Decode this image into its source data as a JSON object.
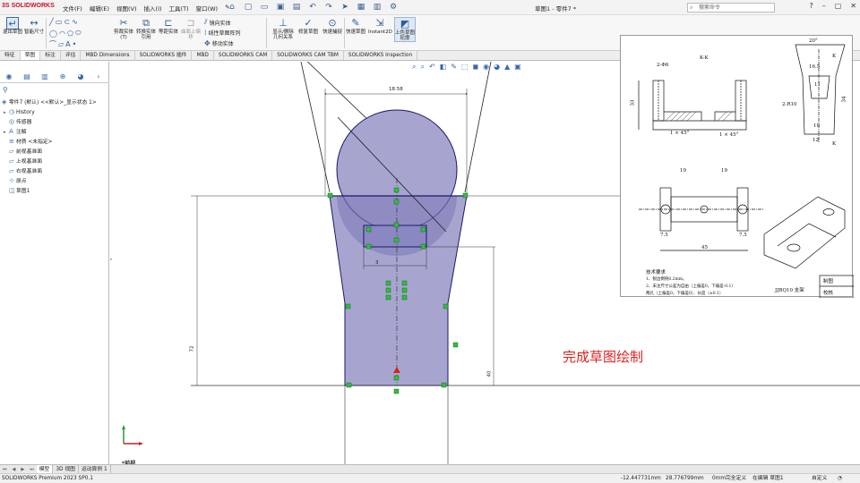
{
  "app": {
    "logo_text": "SOLIDWORKS",
    "logo_mark": "3S",
    "document_title": "草图1 - 零件7 *"
  },
  "menu": {
    "items": [
      "文件(F)",
      "编辑(E)",
      "视图(V)",
      "插入(I)",
      "工具(T)",
      "窗口(W)"
    ]
  },
  "search": {
    "placeholder": "搜索命令"
  },
  "ribbon": {
    "buttons": [
      {
        "label": "退出草图",
        "icon": "exit-sketch-icon"
      },
      {
        "label": "智能尺寸",
        "icon": "smart-dimension-icon"
      },
      {
        "label": "剪裁实体(T)",
        "icon": "trim-icon"
      },
      {
        "label": "转换实体引用",
        "icon": "convert-entities-icon"
      },
      {
        "label": "等距实体",
        "icon": "offset-entities-icon"
      },
      {
        "label": "曲面上偏移",
        "icon": "offset-surface-icon"
      },
      {
        "label": "显示/删除几何关系",
        "icon": "relations-icon"
      },
      {
        "label": "修复草图",
        "icon": "repair-sketch-icon"
      },
      {
        "label": "快速捕捉",
        "icon": "quick-snap-icon"
      },
      {
        "label": "快速草图",
        "icon": "rapid-sketch-icon"
      },
      {
        "label": "Instant2D",
        "icon": "instant2d-icon"
      },
      {
        "label": "上色草图轮廓",
        "icon": "shaded-sketch-icon"
      }
    ],
    "small_items": [
      "镜向实体",
      "线性草图阵列",
      "移动实体"
    ]
  },
  "command_tabs": [
    "特征",
    "草图",
    "标注",
    "评估",
    "MBD Dimensions",
    "SOLIDWORKS 插件",
    "MBD",
    "SOLIDWORKS CAM",
    "SOLIDWORKS CAM TBM",
    "SOLIDWORKS Inspection"
  ],
  "active_command_tab": "草图",
  "tree": {
    "root": "零件7 (默认) <<默认>_显示状态 1>",
    "items": [
      {
        "label": "History",
        "icon": "history-icon",
        "expandable": true
      },
      {
        "label": "传感器",
        "icon": "sensor-icon",
        "expandable": false
      },
      {
        "label": "注解",
        "icon": "annotation-icon",
        "expandable": true
      },
      {
        "label": "材质 <未指定>",
        "icon": "material-icon",
        "expandable": false
      },
      {
        "label": "前视基准面",
        "icon": "plane-icon",
        "expandable": false
      },
      {
        "label": "上视基准面",
        "icon": "plane-icon",
        "expandable": false
      },
      {
        "label": "右视基准面",
        "icon": "plane-icon",
        "expandable": false
      },
      {
        "label": "原点",
        "icon": "origin-icon",
        "expandable": false
      },
      {
        "label": "草图1",
        "icon": "sketch-icon",
        "expandable": false
      }
    ]
  },
  "sketch": {
    "dim_top": "18.58",
    "dim_left": "72",
    "dim_right": "40",
    "dim_inner": "3",
    "view_name": "*前视"
  },
  "overlay_caption": "完成草图绘制",
  "reference": {
    "section_label": "K-K",
    "k_marks": [
      "K",
      "K"
    ],
    "dims": [
      "2-Φ6",
      "33",
      "1 × 45°",
      "1 × 45°",
      "20°",
      "16.5",
      "11",
      "2-R10",
      "10",
      "12",
      "19",
      "19",
      "45",
      "7.5",
      "7.5",
      "34"
    ],
    "notes_title": "技术要求",
    "notes": [
      "1、锐边倒钝0.2mm。",
      "2、未注尺寸公差为自由（上偏差0，下偏差-0.1）",
      "两孔（上偏差0，下偏差0）、长度（±0.1）"
    ],
    "part_name": "JJBQ10 支架",
    "table": [
      "制图",
      "校核"
    ]
  },
  "bottom_tabs": [
    "模型",
    "3D 视图",
    "运动算例 1"
  ],
  "active_bottom_tab": "模型",
  "status": {
    "version": "SOLIDWORKS Premium 2023 SP0.1",
    "x": "-12.447731mm",
    "y": "28.776799mm",
    "z": "0mm",
    "state": "完全定义",
    "editing": "在编辑 草图1",
    "custom": "自定义"
  }
}
